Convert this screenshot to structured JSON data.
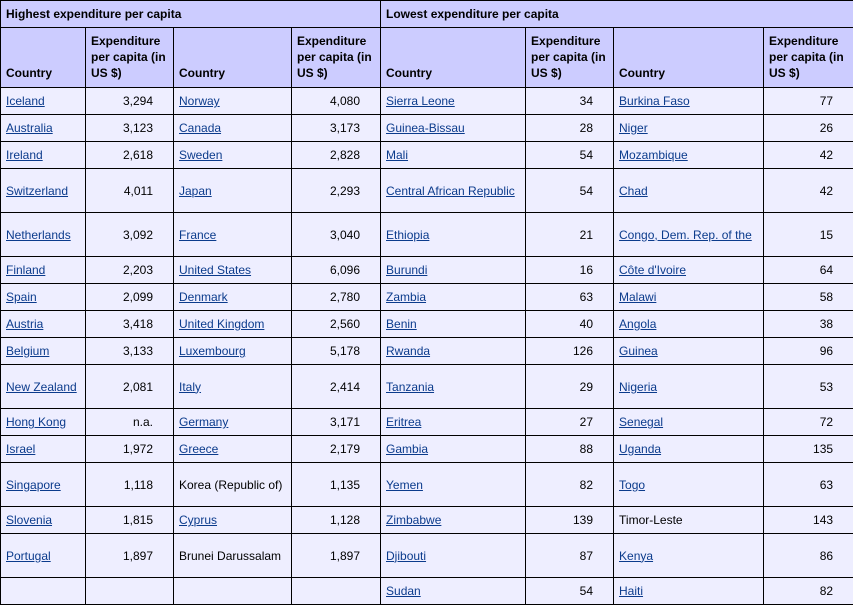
{
  "groups": {
    "highest": "Highest expenditure per capita",
    "lowest": "Lowest expenditure per capita"
  },
  "columns": {
    "country": "Country",
    "expenditure": "Expenditure per capita (in US $)"
  },
  "rows": [
    {
      "h1c": "Iceland",
      "h1v": "3,294",
      "h2c": "Norway",
      "h2v": "4,080",
      "l1c": "Sierra Leone",
      "l1v": "34",
      "l2c": "Burkina Faso",
      "l2v": "77"
    },
    {
      "h1c": "Australia",
      "h1v": "3,123",
      "h2c": "Canada",
      "h2v": "3,173",
      "l1c": "Guinea-Bissau",
      "l1v": "28",
      "l2c": "Niger",
      "l2v": "26"
    },
    {
      "h1c": "Ireland",
      "h1v": "2,618",
      "h2c": "Sweden",
      "h2v": "2,828",
      "l1c": "Mali",
      "l1v": "54",
      "l2c": "Mozambique",
      "l2v": "42"
    },
    {
      "h1c": "Switzerland",
      "h1v": "4,011",
      "h2c": "Japan",
      "h2v": "2,293",
      "l1c": "Central African Republic",
      "l1v": "54",
      "l2c": "Chad",
      "l2v": "42"
    },
    {
      "h1c": "Netherlands",
      "h1v": "3,092",
      "h2c": "France",
      "h2v": "3,040",
      "l1c": "Ethiopia",
      "l1v": "21",
      "l2c": "Congo, Dem. Rep. of the",
      "l2v": "15"
    },
    {
      "h1c": "Finland",
      "h1v": "2,203",
      "h2c": "United States",
      "h2v": "6,096",
      "l1c": "Burundi",
      "l1v": "16",
      "l2c": "Côte d'Ivoire",
      "l2v": "64"
    },
    {
      "h1c": "Spain",
      "h1v": "2,099",
      "h2c": "Denmark",
      "h2v": "2,780",
      "l1c": "Zambia",
      "l1v": "63",
      "l2c": "Malawi",
      "l2v": "58"
    },
    {
      "h1c": "Austria",
      "h1v": "3,418",
      "h2c": "United Kingdom",
      "h2v": "2,560",
      "l1c": "Benin",
      "l1v": "40",
      "l2c": "Angola",
      "l2v": "38"
    },
    {
      "h1c": "Belgium",
      "h1v": "3,133",
      "h2c": "Luxembourg",
      "h2v": "5,178",
      "l1c": "Rwanda",
      "l1v": "126",
      "l2c": "Guinea",
      "l2v": "96"
    },
    {
      "h1c": "New Zealand",
      "h1v": "2,081",
      "h2c": "Italy",
      "h2v": "2,414",
      "l1c": "Tanzania",
      "l1v": "29",
      "l2c": "Nigeria",
      "l2v": "53"
    },
    {
      "h1c": "Hong Kong",
      "h1v": "n.a.",
      "h2c": "Germany",
      "h2v": "3,171",
      "l1c": "Eritrea",
      "l1v": "27",
      "l2c": "Senegal",
      "l2v": "72"
    },
    {
      "h1c": "Israel",
      "h1v": "1,972",
      "h2c": "Greece",
      "h2v": "2,179",
      "l1c": "Gambia",
      "l1v": "88",
      "l2c": "Uganda",
      "l2v": "135"
    },
    {
      "h1c": "Singapore",
      "h1v": "1,118",
      "h2c": "Korea (Republic of)",
      "h2v": "1,135",
      "l1c": "Yemen",
      "l1v": "82",
      "l2c": "Togo",
      "l2v": "63"
    },
    {
      "h1c": "Slovenia",
      "h1v": "1,815",
      "h2c": "Cyprus",
      "h2v": "1,128",
      "l1c": "Zimbabwe",
      "l1v": "139",
      "l2c": "Timor-Leste",
      "l2v": "143"
    },
    {
      "h1c": "Portugal",
      "h1v": "1,897",
      "h2c": "Brunei Darussalam",
      "h2v": "1,897",
      "l1c": "Djibouti",
      "l1v": "87",
      "l2c": "Kenya",
      "l2v": "86"
    },
    {
      "h1c": "",
      "h1v": "",
      "h2c": "",
      "h2v": "",
      "l1c": "Sudan",
      "l1v": "54",
      "l2c": "Haiti",
      "l2v": "82"
    }
  ]
}
